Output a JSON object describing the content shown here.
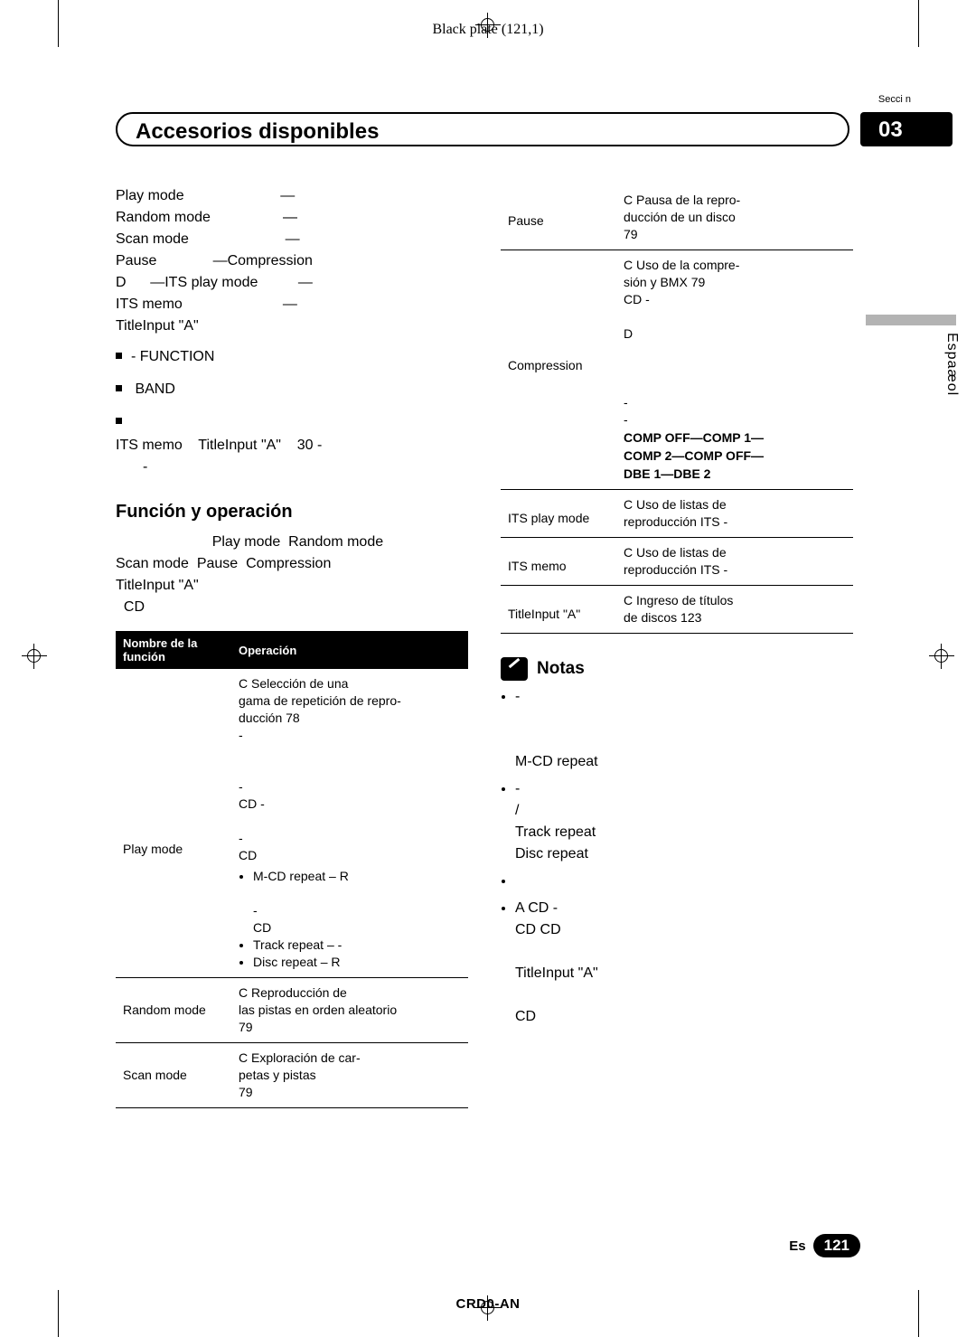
{
  "page": {
    "black_plate": "Black plate (121,1)",
    "seccion_label": "Secci n",
    "title": "Accesorios disponibles",
    "chapter": "03",
    "side_language": "Espaæol",
    "footer_code": "CRD0-AN",
    "page_marker_lang": "Es",
    "page_number": "121"
  },
  "left_column": {
    "intro_lines": [
      "Play mode                        —",
      "Random mode                  —",
      "Scan mode                        —",
      "Pause              —Compression",
      "D      —ITS play mode          —",
      "ITS memo                         —",
      "TitleInput \"A\""
    ],
    "bullets": [
      "-\n            FUNCTION",
      "\n        BAND",
      ""
    ],
    "after_bullets": [
      "ITS memo    TitleInput \"A\"    30 -",
      "-"
    ],
    "heading": "Función y operación",
    "body_lines": [
      "                        Play mode  Random mode",
      "Scan mode  Pause  Compression",
      "TitleInput \"A\"",
      "  CD"
    ],
    "table": {
      "headers": [
        "Nombre de la función",
        "Operación"
      ],
      "rows": [
        {
          "name": "Play mode",
          "operation": "C              Selección de una\ngama de repetición de repro-\nducción   78\n     -\n\n\n     -\n  CD -\n\n     -\n    CD",
          "sub_bullets": [
            "M-CD repeat – R",
            "\n        -\n      CD",
            "Track repeat –  -",
            "Disc repeat – R"
          ]
        },
        {
          "name": "Random mode",
          "operation": "C            Reproducción de\nlas pistas en orden aleatorio\n   79",
          "sub_bullets": []
        },
        {
          "name": "Scan mode",
          "operation": "C            Exploración de car-\npetas y pistas\n   79",
          "sub_bullets": []
        }
      ]
    }
  },
  "right_column": {
    "table": {
      "rows": [
        {
          "name": "Pause",
          "operation": "C              Pausa de la repro-\nducción de un disco\n   79",
          "extra": []
        },
        {
          "name": "Compression",
          "operation": "C              Uso de la compre-\nsión y BMX   79\n     CD -\n\nD\n\n\n\n          -\n          -\n",
          "extra": [
            "COMP OFF—COMP 1—",
            "COMP 2—COMP OFF—",
            "DBE 1—DBE 2"
          ]
        },
        {
          "name": "ITS play mode",
          "operation": "C             Uso de listas de\nreproducción ITS  -",
          "extra": []
        },
        {
          "name": "ITS memo",
          "operation": "C             Uso de listas de\nreproducción ITS  -",
          "extra": []
        },
        {
          "name": "TitleInput \"A\"",
          "operation": "C             Ingreso de títulos\nde discos   123",
          "extra": []
        }
      ]
    },
    "notas_heading": "Notas",
    "notas": [
      "     -\n\n\n        M-CD repeat",
      "     -\n /\n  Track repeat\n  Disc repeat",
      "",
      "A   CD   -\n  CD   CD\n\n                TitleInput \"A\"\n\n  CD"
    ]
  }
}
